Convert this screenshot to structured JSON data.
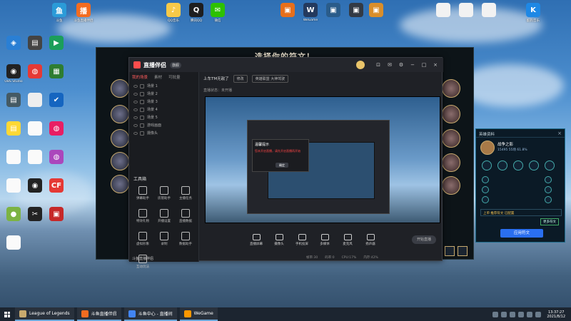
{
  "desktop": {
    "icons": [
      {
        "id": "app1",
        "label": "斗鱼",
        "color": "#2b9bd8",
        "glyph": "鱼"
      },
      {
        "id": "app2",
        "label": "斗鱼直播伴侣",
        "color": "#f36c21",
        "glyph": "播"
      },
      {
        "id": "app3",
        "label": "QQ音乐",
        "color": "#f7c948",
        "glyph": "♪"
      },
      {
        "id": "app4",
        "label": "腾讯QQ",
        "color": "#1e1e1e",
        "glyph": "Q"
      },
      {
        "id": "app5",
        "label": "微信",
        "color": "#2dc100",
        "glyph": "✉"
      },
      {
        "id": "app6",
        "label": "",
        "color": "#e76f1b",
        "glyph": "▣"
      },
      {
        "id": "app7",
        "label": "WeGame",
        "color": "#243a5e",
        "glyph": "W"
      },
      {
        "id": "app8",
        "label": "",
        "color": "#2a5c8a",
        "glyph": "▣"
      },
      {
        "id": "app9",
        "label": "",
        "color": "#333a44",
        "glyph": "▣"
      },
      {
        "id": "app10",
        "label": "",
        "color": "#d98e2b",
        "glyph": "▣"
      },
      {
        "id": "app11",
        "label": "",
        "color": "#f2f2f2",
        "glyph": ""
      },
      {
        "id": "app12",
        "label": "",
        "color": "#f2f2f2",
        "glyph": ""
      },
      {
        "id": "app13",
        "label": "",
        "color": "#f2f2f2",
        "glyph": ""
      },
      {
        "id": "app14",
        "label": "酷狗音乐",
        "color": "#1e88e5",
        "glyph": "K"
      }
    ],
    "left_icons": [
      {
        "label": "",
        "color": "#2a7fd4",
        "glyph": "◈"
      },
      {
        "label": "",
        "color": "#444",
        "glyph": "▤"
      },
      {
        "label": "",
        "color": "#1b9e5a",
        "glyph": "▶"
      },
      {
        "label": "OBS Studio",
        "color": "#222",
        "glyph": "◉"
      },
      {
        "label": "",
        "color": "#e53935",
        "glyph": "◍"
      },
      {
        "label": "",
        "color": "#2e7d32",
        "glyph": "▦"
      },
      {
        "label": "",
        "color": "#455a64",
        "glyph": "▤"
      },
      {
        "label": "",
        "color": "#eee",
        "glyph": ""
      },
      {
        "label": "",
        "color": "#1565c0",
        "glyph": "✔"
      },
      {
        "label": "",
        "color": "#fdd835",
        "glyph": "▤"
      },
      {
        "label": "",
        "color": "#fafafa",
        "glyph": ""
      },
      {
        "label": "",
        "color": "#e91e63",
        "glyph": "◍"
      },
      {
        "label": "",
        "color": "#fafafa",
        "glyph": ""
      },
      {
        "label": "",
        "color": "#fafafa",
        "glyph": ""
      },
      {
        "label": "",
        "color": "#ab47bc",
        "glyph": "◍"
      },
      {
        "label": "",
        "color": "#fafafa",
        "glyph": ""
      },
      {
        "label": "",
        "color": "#222",
        "glyph": "◉"
      },
      {
        "label": "",
        "color": "#e53935",
        "glyph": "CF"
      },
      {
        "label": "",
        "color": "#7cb342",
        "glyph": "●"
      },
      {
        "label": "",
        "color": "#222",
        "glyph": "✂"
      },
      {
        "label": "",
        "color": "#c62828",
        "glyph": "▣"
      },
      {
        "label": "",
        "color": "#fafafa",
        "glyph": ""
      }
    ]
  },
  "game_window": {
    "title": "选择你的符文！"
  },
  "stream_window": {
    "app_name": "直播伴侣",
    "badge": "旗舰",
    "sidebar_tabs": [
      "我的场景",
      "素材",
      "可批量"
    ],
    "scenes": [
      "场景 1",
      "场景 2",
      "场景 3",
      "场景 4",
      "场景 5",
      "游戏画面",
      "摄像头"
    ],
    "toolbox_label": "工具箱",
    "tools": [
      "弹幕助手",
      "房管助手",
      "主播任务",
      "特效礼物",
      "开播设置",
      "直播数据",
      "虚拟形象",
      "录制",
      "数据助手",
      "互动玩法"
    ],
    "header_title": "上车TM无敌了",
    "header_pill1": "修改",
    "header_pill2": "英雄联盟 大神驾驶",
    "subheader": "直播状态：未开播",
    "toast_title": "温馨提示",
    "toast_message": "您未开启直播，请先开启直播再开始",
    "toast_button": "确定",
    "bottom_buttons": [
      "直播屏幕",
      "摄像头",
      "手机投屏",
      "多媒体",
      "麦克风",
      "扬声器"
    ],
    "start_live": "开始直播",
    "status": [
      "帧率:30",
      "码率:0",
      "CPU:17%",
      "内存:42%"
    ],
    "footer": "斗鱼直播伴侣"
  },
  "rune_panel": {
    "title": "英雄资料",
    "close": "×",
    "champion_name": "战争之影",
    "champion_stats": "15495  55场  61.8%",
    "select_label": "上单 推荐符文 已配置",
    "more": "更多符文",
    "apply": "应用符文"
  },
  "taskbar": {
    "tasks": [
      {
        "label": "League of Legends",
        "color": "#c8aa6e"
      },
      {
        "label": "斗鱼直播伴侣",
        "color": "#f36c21"
      },
      {
        "label": "斗鱼中心 - 直播间",
        "color": "#4285f4"
      },
      {
        "label": "WeGame",
        "color": "#ff9800"
      }
    ],
    "time": "13:37:27",
    "date": "2021/8/12"
  }
}
